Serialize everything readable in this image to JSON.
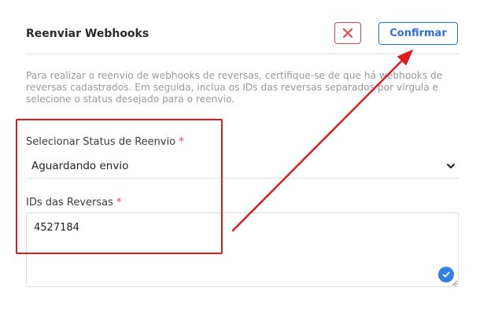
{
  "dialog": {
    "title": "Reenviar Webhooks",
    "close_icon": "close-icon",
    "confirm_label": "Confirmar",
    "description": "Para realizar o reenvio de webhooks de reversas, certifique-se de que há webhooks de reversas cadastrados. Em seguida, inclua os IDs das reversas separados por vírgula e selecione o status desejado para o reenvio."
  },
  "status_field": {
    "label": "Selecionar Status de Reenvio",
    "required_mark": "*",
    "value": "Aguardando envio",
    "icon": "chevron-down-icon"
  },
  "ids_field": {
    "label": "IDs das Reversas",
    "required_mark": "*",
    "value": "4527184",
    "badge_icon": "check-circle-icon"
  },
  "annotation": {
    "color": "#e11b1b",
    "shapes": [
      "highlight-box",
      "arrow"
    ]
  },
  "colors": {
    "primary": "#2e6fd6",
    "danger": "#e0444c"
  }
}
